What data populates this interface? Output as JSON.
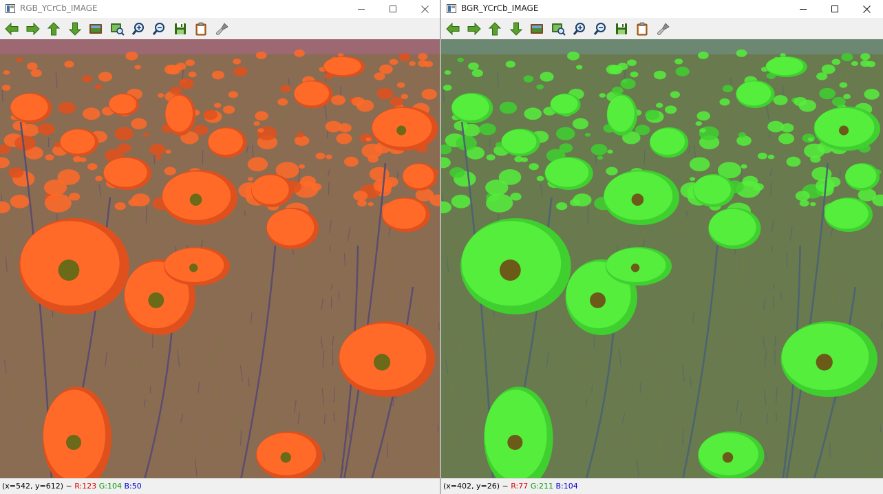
{
  "windows": [
    {
      "title": "RGB_YCrCb_IMAGE",
      "status": {
        "coords": "(x=542, y=612) ~ ",
        "r": "R:123",
        "g": "G:104",
        "b": "B:50"
      },
      "palette": {
        "background": "#8a6c53",
        "sky": "#a0697a",
        "flower": "#ff6a28",
        "flower_dark": "#e0501c",
        "flower_center": "#6b6a18",
        "stem": "#5c4c6e",
        "grass": "#7b7d3a"
      }
    },
    {
      "title": "BGR_YCrCb_IMAGE",
      "status": {
        "coords": "(x=402, y=26) ~ ",
        "r": "R:77",
        "g": "G:211",
        "b": "B:104"
      },
      "palette": {
        "background": "#687a4e",
        "sky": "#6e8c7c",
        "flower": "#55ee3c",
        "flower_dark": "#3fd030",
        "flower_center": "#6b5a18",
        "stem": "#4c6470",
        "grass": "#7b7d3a"
      }
    }
  ],
  "toolbar": [
    {
      "name": "pan-left-icon",
      "label": "Pan left"
    },
    {
      "name": "pan-right-icon",
      "label": "Pan right"
    },
    {
      "name": "pan-up-icon",
      "label": "Pan up"
    },
    {
      "name": "pan-down-icon",
      "label": "Pan down"
    },
    {
      "name": "zoom-original-icon",
      "label": "Zoom x1"
    },
    {
      "name": "zoom-fit-icon",
      "label": "Zoom adjusted"
    },
    {
      "name": "zoom-in-icon",
      "label": "Zoom in"
    },
    {
      "name": "zoom-out-icon",
      "label": "Zoom out"
    },
    {
      "name": "save-icon",
      "label": "Save current image"
    },
    {
      "name": "copy-clipboard-icon",
      "label": "Copy image to clipboard"
    },
    {
      "name": "properties-icon",
      "label": "Display properties window"
    }
  ],
  "window_controls": [
    "minimize-button",
    "maximize-button",
    "close-button"
  ]
}
